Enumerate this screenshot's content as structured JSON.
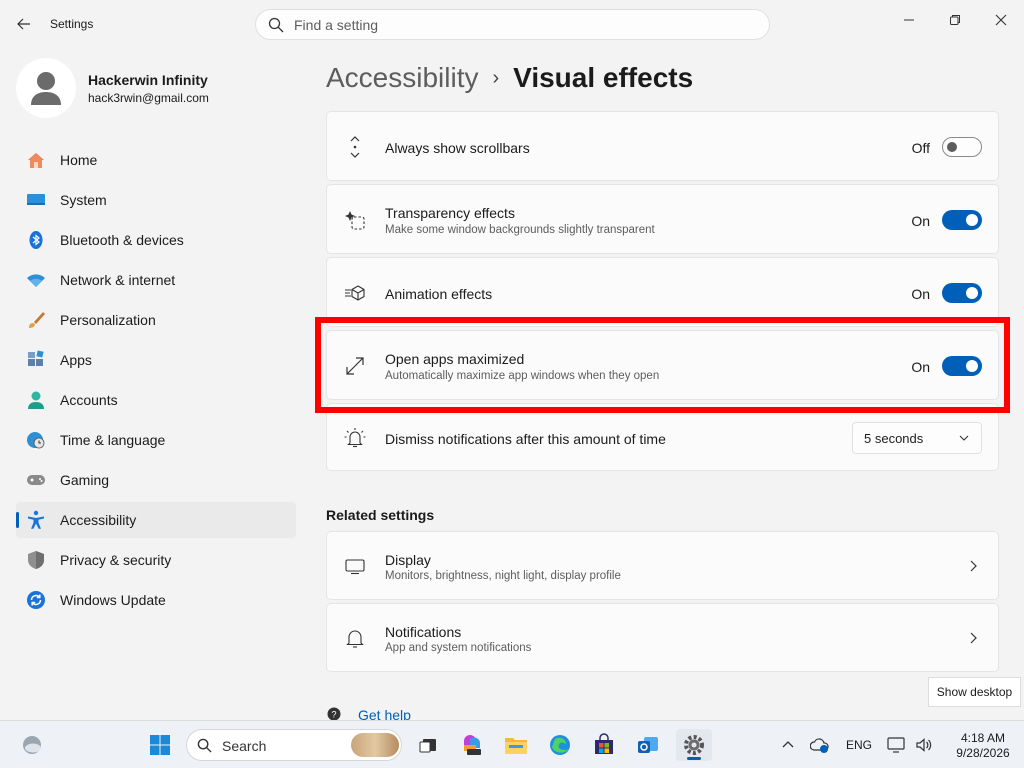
{
  "window": {
    "title": "Settings"
  },
  "search": {
    "placeholder": "Find a setting"
  },
  "profile": {
    "name": "Hackerwin Infinity",
    "email": "hack3rwin@gmail.com"
  },
  "sidebar": {
    "items": [
      {
        "label": "Home",
        "icon": "home-icon"
      },
      {
        "label": "System",
        "icon": "system-icon"
      },
      {
        "label": "Bluetooth & devices",
        "icon": "bluetooth-icon"
      },
      {
        "label": "Network & internet",
        "icon": "wifi-icon"
      },
      {
        "label": "Personalization",
        "icon": "brush-icon"
      },
      {
        "label": "Apps",
        "icon": "apps-icon"
      },
      {
        "label": "Accounts",
        "icon": "accounts-icon"
      },
      {
        "label": "Time & language",
        "icon": "clock-globe-icon"
      },
      {
        "label": "Gaming",
        "icon": "gamepad-icon"
      },
      {
        "label": "Accessibility",
        "icon": "accessibility-icon",
        "active": true
      },
      {
        "label": "Privacy & security",
        "icon": "shield-icon"
      },
      {
        "label": "Windows Update",
        "icon": "update-icon"
      }
    ]
  },
  "breadcrumb": {
    "parent": "Accessibility",
    "separator": "›",
    "current": "Visual effects"
  },
  "settings": {
    "scrollbars": {
      "title": "Always show scrollbars",
      "state": "Off"
    },
    "transparency": {
      "title": "Transparency effects",
      "subtitle": "Make some window backgrounds slightly transparent",
      "state": "On"
    },
    "animation": {
      "title": "Animation effects",
      "state": "On"
    },
    "maximized": {
      "title": "Open apps maximized",
      "subtitle": "Automatically maximize app windows when they open",
      "state": "On"
    },
    "dismiss": {
      "title": "Dismiss notifications after this amount of time",
      "value": "5 seconds"
    }
  },
  "related": {
    "heading": "Related settings",
    "display": {
      "title": "Display",
      "subtitle": "Monitors, brightness, night light, display profile"
    },
    "notifications": {
      "title": "Notifications",
      "subtitle": "App and system notifications"
    }
  },
  "help": {
    "label": "Get help"
  },
  "tooltip": {
    "label": "Show desktop"
  },
  "taskbar": {
    "search_label": "Search",
    "language": "ENG",
    "time": "4:18 AM",
    "date": "9/28/2026"
  },
  "colors": {
    "accent": "#005fb8",
    "highlight": "#ff0000"
  }
}
